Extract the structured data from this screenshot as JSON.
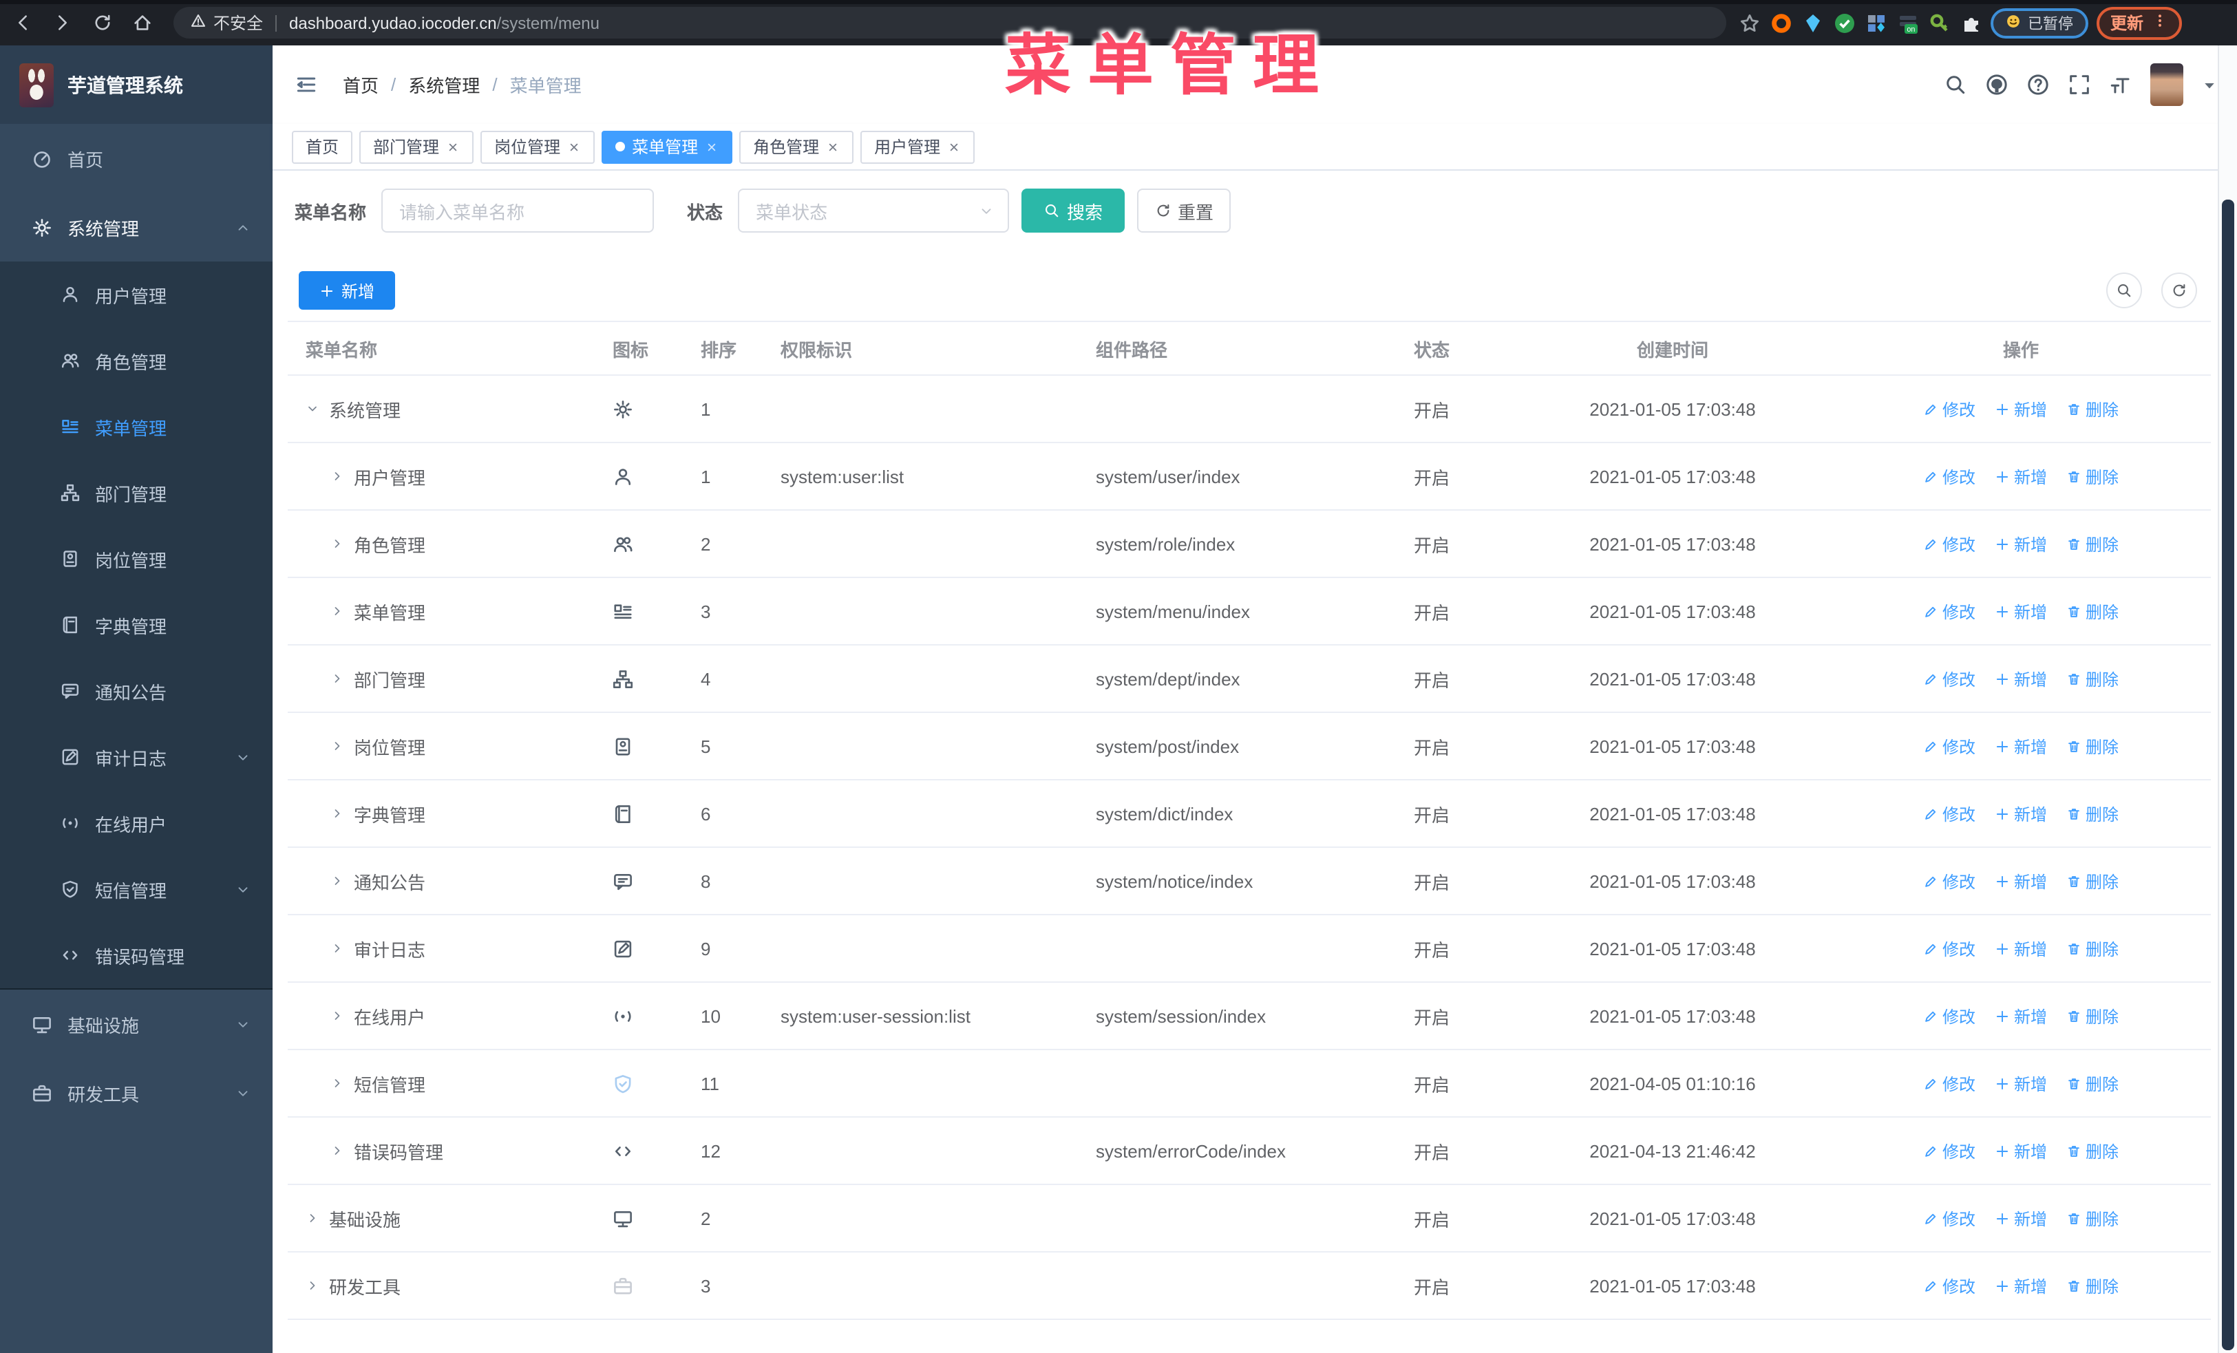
{
  "browser": {
    "security_label": "不安全",
    "url_host": "dashboard.yudao.iocoder.cn",
    "url_path": "/system/menu",
    "paused_badge_label": "已暂停",
    "update_button_label": "更新",
    "extensions": [
      {
        "icon": "ext-orange-ring-icon",
        "shape": "ring",
        "color": "#ff6d00"
      },
      {
        "icon": "ext-blue-gem-icon",
        "shape": "gem",
        "color": "#4fc3f7"
      },
      {
        "icon": "ext-green-check-icon",
        "shape": "check",
        "color": "#2e9e4f"
      },
      {
        "icon": "ext-grid-icon",
        "shape": "grid",
        "color": "#5c8fd6"
      },
      {
        "icon": "ext-on-switch-icon",
        "shape": "onswitch",
        "color": "#21a453",
        "badge": "on"
      },
      {
        "icon": "ext-green-key-icon",
        "shape": "key",
        "color": "#7cb342"
      },
      {
        "icon": "ext-puzzle-icon",
        "shape": "puzzle",
        "color": "#e8eaed"
      }
    ]
  },
  "overlay_title": "菜单管理",
  "app": {
    "logo_title": "芋道管理系统",
    "breadcrumb": [
      "首页",
      "系统管理",
      "菜单管理"
    ],
    "sidebar_items": [
      {
        "label": "首页",
        "icon": "dashboard-icon",
        "glyph": "dashboard",
        "level": 1
      },
      {
        "label": "系统管理",
        "icon": "gear-icon",
        "glyph": "gear",
        "level": 1,
        "arrow": "up",
        "parent_active": true
      },
      {
        "label": "用户管理",
        "icon": "user-icon",
        "glyph": "user",
        "level": 2
      },
      {
        "label": "角色管理",
        "icon": "users-icon",
        "glyph": "users",
        "level": 2
      },
      {
        "label": "菜单管理",
        "icon": "menu-list-icon",
        "glyph": "menu",
        "level": 2,
        "active": true
      },
      {
        "label": "部门管理",
        "icon": "org-tree-icon",
        "glyph": "sitemap",
        "level": 2
      },
      {
        "label": "岗位管理",
        "icon": "id-badge-icon",
        "glyph": "badge",
        "level": 2
      },
      {
        "label": "字典管理",
        "icon": "dictionary-icon",
        "glyph": "dict",
        "level": 2
      },
      {
        "label": "通知公告",
        "icon": "notice-icon",
        "glyph": "notice",
        "level": 2
      },
      {
        "label": "审计日志",
        "icon": "audit-log-icon",
        "glyph": "log",
        "level": 2,
        "arrow": "down"
      },
      {
        "label": "在线用户",
        "icon": "online-user-icon",
        "glyph": "online",
        "level": 2
      },
      {
        "label": "短信管理",
        "icon": "sms-shield-icon",
        "glyph": "sms",
        "level": 2,
        "arrow": "down"
      },
      {
        "label": "错误码管理",
        "icon": "error-code-icon",
        "glyph": "code",
        "level": 2
      },
      {
        "label": "基础设施",
        "icon": "infrastructure-icon",
        "glyph": "infra",
        "level": 1,
        "arrow": "down"
      },
      {
        "label": "研发工具",
        "icon": "dev-tool-icon",
        "glyph": "tool",
        "level": 1,
        "arrow": "down"
      }
    ],
    "tabs": [
      {
        "label": "首页",
        "closable": false,
        "active": false
      },
      {
        "label": "部门管理",
        "closable": true,
        "active": false
      },
      {
        "label": "岗位管理",
        "closable": true,
        "active": false
      },
      {
        "label": "菜单管理",
        "closable": true,
        "active": true
      },
      {
        "label": "角色管理",
        "closable": true,
        "active": false
      },
      {
        "label": "用户管理",
        "closable": true,
        "active": false
      }
    ],
    "search": {
      "name_label": "菜单名称",
      "name_placeholder": "请输入菜单名称",
      "status_label": "状态",
      "status_placeholder": "菜单状态",
      "search_label": "搜索",
      "reset_label": "重置"
    },
    "toolbar": {
      "add_label": "新增"
    },
    "table": {
      "headers": [
        "菜单名称",
        "图标",
        "排序",
        "权限标识",
        "组件路径",
        "状态",
        "创建时间",
        "操作"
      ],
      "actions": {
        "edit": "修改",
        "add": "新增",
        "delete": "删除"
      },
      "rows": [
        {
          "name": "系统管理",
          "glyph": "gear",
          "icon": "gear-icon",
          "level": 1,
          "expanded": true,
          "sort": "1",
          "perm": "",
          "path": "",
          "status": "开启",
          "time": "2021-01-05 17:03:48"
        },
        {
          "name": "用户管理",
          "glyph": "user",
          "icon": "user-icon",
          "level": 2,
          "sort": "1",
          "perm": "system:user:list",
          "path": "system/user/index",
          "status": "开启",
          "time": "2021-01-05 17:03:48"
        },
        {
          "name": "角色管理",
          "glyph": "users",
          "icon": "users-icon",
          "level": 2,
          "sort": "2",
          "perm": "",
          "path": "system/role/index",
          "status": "开启",
          "time": "2021-01-05 17:03:48"
        },
        {
          "name": "菜单管理",
          "glyph": "menu",
          "icon": "menu-list-icon",
          "level": 2,
          "sort": "3",
          "perm": "",
          "path": "system/menu/index",
          "status": "开启",
          "time": "2021-01-05 17:03:48"
        },
        {
          "name": "部门管理",
          "glyph": "sitemap",
          "icon": "org-tree-icon",
          "level": 2,
          "sort": "4",
          "perm": "",
          "path": "system/dept/index",
          "status": "开启",
          "time": "2021-01-05 17:03:48"
        },
        {
          "name": "岗位管理",
          "glyph": "badge",
          "icon": "id-badge-icon",
          "level": 2,
          "sort": "5",
          "perm": "",
          "path": "system/post/index",
          "status": "开启",
          "time": "2021-01-05 17:03:48"
        },
        {
          "name": "字典管理",
          "glyph": "dict",
          "icon": "dictionary-icon",
          "level": 2,
          "sort": "6",
          "perm": "",
          "path": "system/dict/index",
          "status": "开启",
          "time": "2021-01-05 17:03:48"
        },
        {
          "name": "通知公告",
          "glyph": "notice",
          "icon": "notice-icon",
          "level": 2,
          "sort": "8",
          "perm": "",
          "path": "system/notice/index",
          "status": "开启",
          "time": "2021-01-05 17:03:48"
        },
        {
          "name": "审计日志",
          "glyph": "log",
          "icon": "audit-log-icon",
          "level": 2,
          "sort": "9",
          "perm": "",
          "path": "",
          "status": "开启",
          "time": "2021-01-05 17:03:48"
        },
        {
          "name": "在线用户",
          "glyph": "online",
          "icon": "online-user-icon",
          "level": 2,
          "sort": "10",
          "perm": "system:user-session:list",
          "path": "system/session/index",
          "status": "开启",
          "time": "2021-01-05 17:03:48"
        },
        {
          "name": "短信管理",
          "glyph": "sms",
          "icon": "sms-shield-icon",
          "icon_color": "#a9cdf2",
          "level": 2,
          "sort": "11",
          "perm": "",
          "path": "",
          "status": "开启",
          "time": "2021-04-05 01:10:16"
        },
        {
          "name": "错误码管理",
          "glyph": "code",
          "icon": "error-code-icon",
          "level": 2,
          "sort": "12",
          "perm": "",
          "path": "system/errorCode/index",
          "status": "开启",
          "time": "2021-04-13 21:46:42"
        },
        {
          "name": "基础设施",
          "glyph": "infra",
          "icon": "infrastructure-icon",
          "level": 1,
          "sort": "2",
          "perm": "",
          "path": "",
          "status": "开启",
          "time": "2021-01-05 17:03:48"
        },
        {
          "name": "研发工具",
          "glyph": "tool",
          "icon": "dev-tool-icon",
          "icon_color": "#c9cdd4",
          "level": 1,
          "sort": "3",
          "perm": "",
          "path": "",
          "status": "开启",
          "time": "2021-01-05 17:03:48"
        }
      ]
    }
  },
  "colors": {
    "accent_blue": "#409eff",
    "add_button_blue": "#1d86f0",
    "search_teal": "#2bb8a8",
    "title_pink": "#fa4a66",
    "sidebar_bg": "#35495e",
    "submenu_bg": "#273848",
    "browser_bar_bg": "#1e2127"
  }
}
